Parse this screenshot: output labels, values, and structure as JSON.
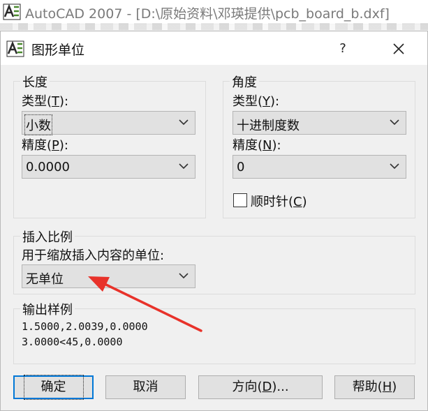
{
  "app": {
    "title": "AutoCAD 2007 - [D:\\原始资料\\邓瑛提供\\pcb_board_b.dxf]"
  },
  "dialog": {
    "title": "图形单位",
    "help_glyph": "?",
    "length": {
      "group_label": "长度",
      "type_label": "类型(",
      "type_key": "T",
      "type_value": "小数",
      "precision_label": "精度(",
      "precision_key": "P",
      "precision_value": "0.0000"
    },
    "angle": {
      "group_label": "角度",
      "type_label": "类型(",
      "type_key": "Y",
      "type_value": "十进制度数",
      "precision_label": "精度(",
      "precision_key": "N",
      "precision_value": "0",
      "clockwise_label": "顺时针(",
      "clockwise_key": "C",
      "clockwise_checked": false
    },
    "insertion": {
      "group_label": "插入比例",
      "caption": "用于缩放插入内容的单位:",
      "value": "无单位"
    },
    "sample": {
      "group_label": "输出样例",
      "line1": "1.5000,2.0039,0.0000",
      "line2": "3.0000<45,0.0000"
    },
    "buttons": {
      "ok": "确定",
      "cancel": "取消",
      "direction_label": "方向(",
      "direction_key": "D",
      "direction_suffix": ")...",
      "help_label": "帮助(",
      "help_key": "H"
    },
    "colors": {
      "accent": "#0078d7",
      "annotation_arrow": "#e8322a"
    }
  }
}
